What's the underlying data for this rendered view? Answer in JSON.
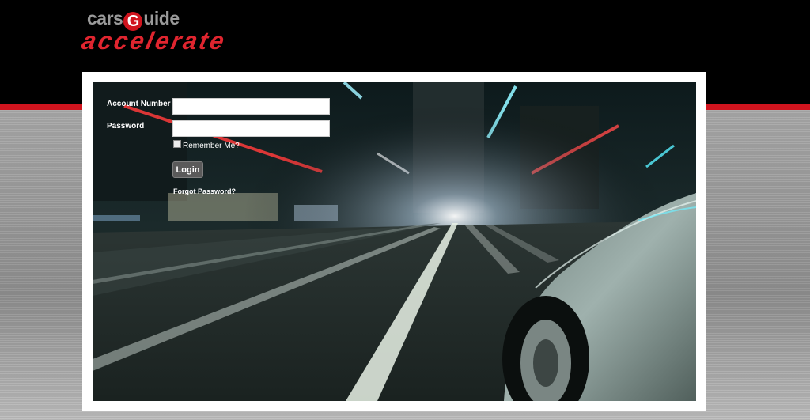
{
  "brand": {
    "top_left": "cars",
    "top_g": "G",
    "top_right": "uide",
    "subtitle": "accelerate",
    "accent_color": "#d0141e"
  },
  "login": {
    "account_label": "Account Number",
    "account_value": "",
    "password_label": "Password",
    "password_value": "",
    "remember_label": "Remember Me?",
    "remember_checked": false,
    "login_button": "Login",
    "forgot_link": "Forgot Password?"
  },
  "icons": {
    "checkbox": "checkbox-icon"
  }
}
